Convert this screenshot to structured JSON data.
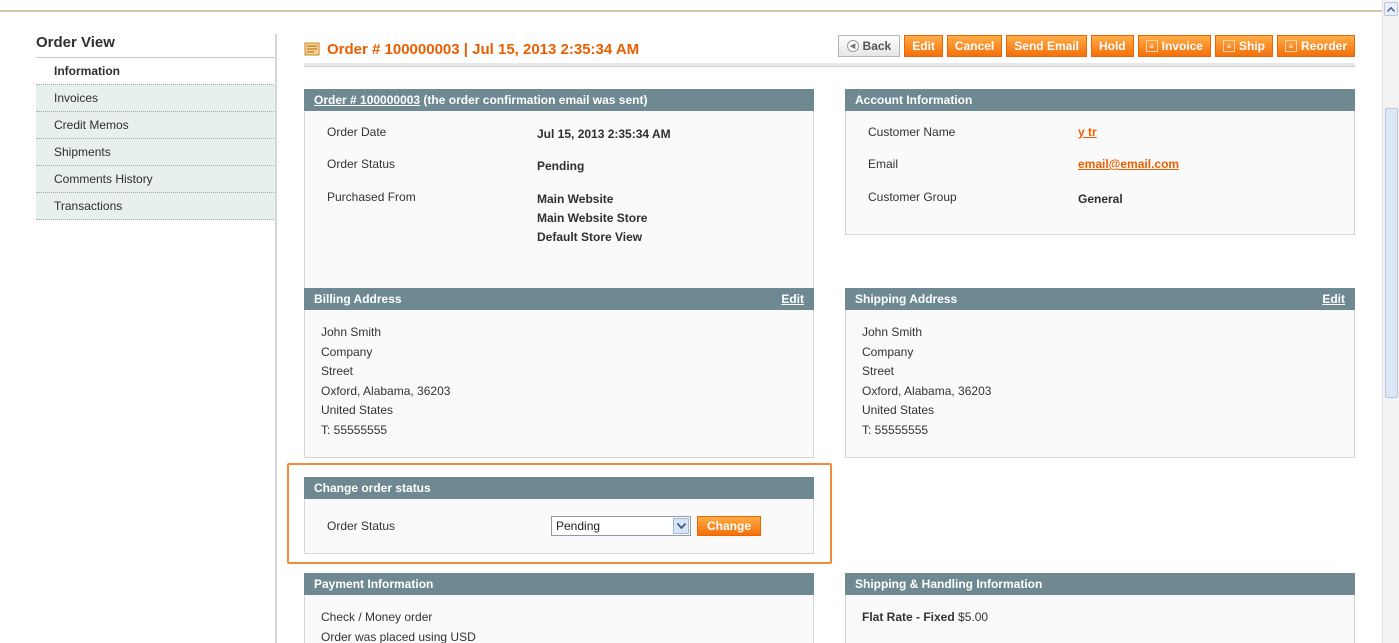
{
  "sidebar": {
    "title": "Order View",
    "tabs": [
      {
        "label": "Information",
        "active": true
      },
      {
        "label": "Invoices"
      },
      {
        "label": "Credit Memos"
      },
      {
        "label": "Shipments"
      },
      {
        "label": "Comments History"
      },
      {
        "label": "Transactions"
      }
    ]
  },
  "header": {
    "title": "Order # 100000003 | Jul 15, 2013 2:35:34 AM",
    "icon": "order-document-icon"
  },
  "toolbar": {
    "back": "Back",
    "edit": "Edit",
    "cancel": "Cancel",
    "send_email": "Send Email",
    "hold": "Hold",
    "invoice": "Invoice",
    "ship": "Ship",
    "reorder": "Reorder"
  },
  "order_info": {
    "head_link": "Order # 100000003",
    "head_suffix": " (the order confirmation email was sent)",
    "order_date_label": "Order Date",
    "order_date": "Jul 15, 2013 2:35:34 AM",
    "order_status_label": "Order Status",
    "order_status": "Pending",
    "purchased_from_label": "Purchased From",
    "purchased_from": [
      "Main Website",
      "Main Website Store",
      "Default Store View"
    ]
  },
  "account_info": {
    "title": "Account Information",
    "customer_name_label": "Customer Name",
    "customer_name": "y tr",
    "email_label": "Email",
    "email": "email@email.com",
    "customer_group_label": "Customer Group",
    "customer_group": "General"
  },
  "billing": {
    "title": "Billing Address",
    "edit": "Edit",
    "lines": [
      "John Smith",
      "Company",
      "Street",
      "Oxford, Alabama, 36203",
      "United States",
      "T: 55555555"
    ]
  },
  "shipping": {
    "title": "Shipping Address",
    "edit": "Edit",
    "lines": [
      "John Smith",
      "Company",
      "Street",
      "Oxford, Alabama, 36203",
      "United States",
      "T: 55555555"
    ]
  },
  "change_status": {
    "title": "Change order status",
    "label": "Order Status",
    "selected": "Pending",
    "button": "Change"
  },
  "payment": {
    "title": "Payment Information",
    "lines": [
      "Check / Money order",
      "Order was placed using USD"
    ]
  },
  "shipping_handling": {
    "title": "Shipping & Handling Information",
    "method": "Flat Rate - Fixed",
    "price": "$5.00"
  },
  "colors": {
    "accent": "#eb5e00",
    "box_header": "#6f8992",
    "highlight": "#f08a3c"
  }
}
